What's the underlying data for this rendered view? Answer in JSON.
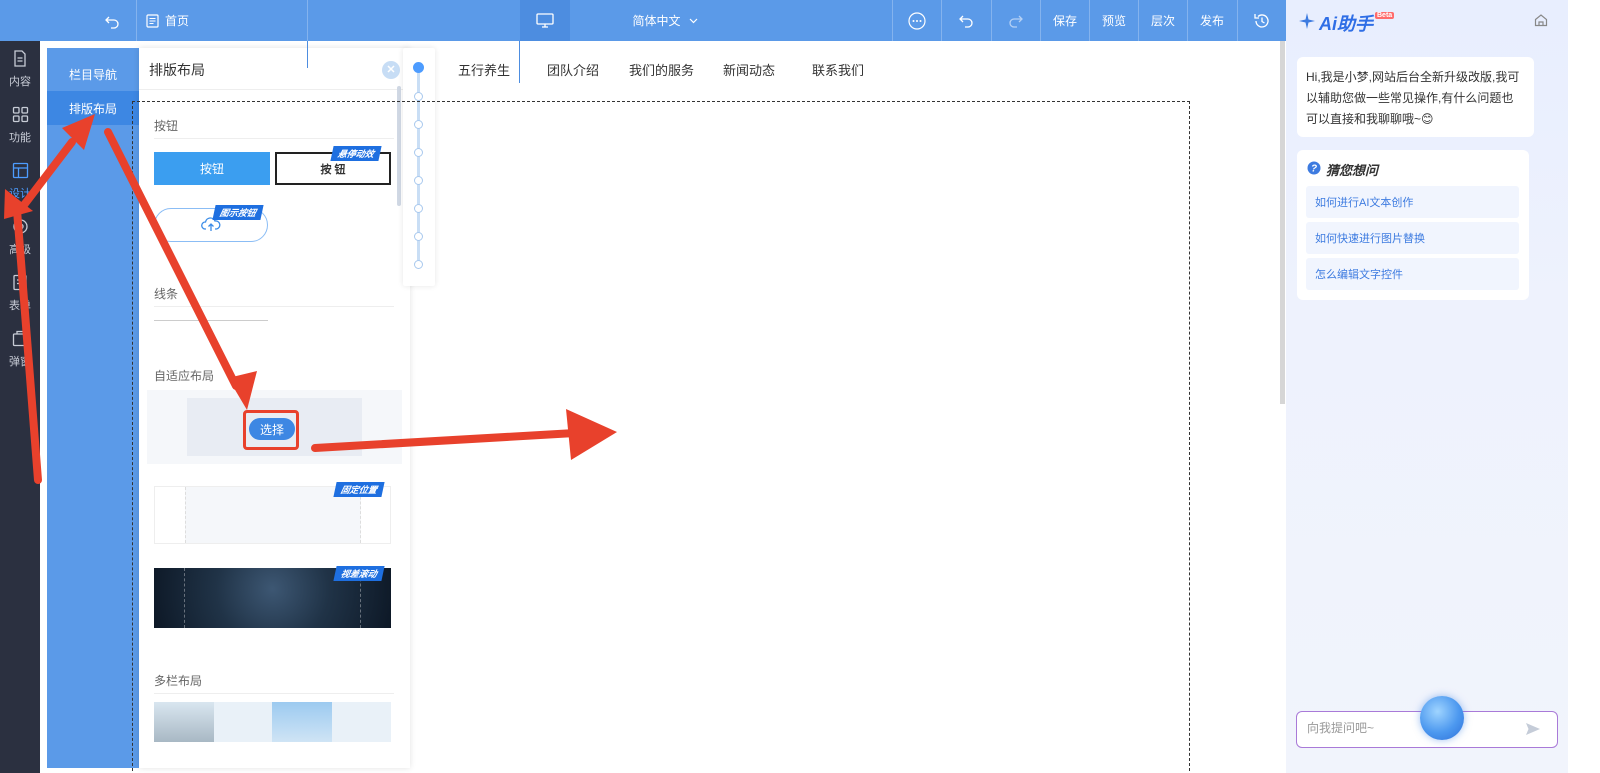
{
  "topbar": {
    "home_label": "首页",
    "language": "简体中文",
    "save": "保存",
    "preview": "预览",
    "layers": "层次",
    "publish": "发布",
    "icons": [
      "back-icon",
      "home-doc-icon",
      "desktop-icon",
      "chevron-down-icon",
      "more-icon",
      "undo-icon",
      "redo-icon",
      "history-icon"
    ]
  },
  "rail": {
    "items": [
      {
        "label": "内容",
        "icon": "file-icon"
      },
      {
        "label": "功能",
        "icon": "grid-icon"
      },
      {
        "label": "设计",
        "icon": "layout-icon",
        "active": true
      },
      {
        "label": "高级",
        "icon": "advanced-icon"
      },
      {
        "label": "表单",
        "icon": "form-icon"
      },
      {
        "label": "弹窗",
        "icon": "popup-icon"
      }
    ]
  },
  "subnav": {
    "items": [
      {
        "label": "栏目导航"
      },
      {
        "label": "排版布局",
        "active": true
      }
    ]
  },
  "panel": {
    "title": "排版布局",
    "sections": {
      "button": "按钮",
      "line": "线条",
      "adaptive": "自适应布局",
      "multi": "多栏布局"
    },
    "demo_button_filled": "按钮",
    "demo_button_outline": "按 钮",
    "badge_hover": "悬停动效",
    "badge_icon": "图示按钮",
    "badge_fixed": "固定位置",
    "badge_parallax": "视差滚动",
    "select_label": "选择"
  },
  "canvas": {
    "nav": [
      "五行养生",
      "团队介绍",
      "我们的服务",
      "新闻动态",
      "联系我们"
    ]
  },
  "ai": {
    "title": "Ai助手",
    "beta": "Beta",
    "greeting": "Hi,我是小梦,网站后台全新升级改版,我可以辅助您做一些常见操作,有什么问题也可以直接和我聊聊哦~😊",
    "guess_title": "猜您想问",
    "questions": [
      "如何进行AI文本创作",
      "如何快速进行图片替换",
      "怎么编辑文字控件"
    ],
    "input_placeholder": "向我提问吧~"
  },
  "colors": {
    "topbar": "#5b9ae8",
    "rail": "#2b3040",
    "accent": "#3d87e3",
    "annotation": "#e8412c"
  }
}
